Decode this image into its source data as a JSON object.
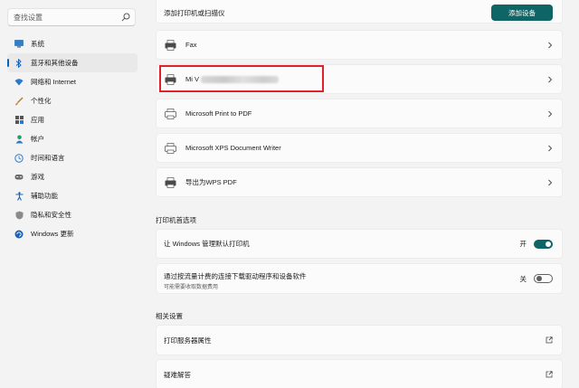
{
  "sidebar": {
    "search_placeholder": "查找设置",
    "items": [
      {
        "label": "系统",
        "icon": "monitor-icon"
      },
      {
        "label": "蓝牙和其他设备",
        "icon": "bluetooth-icon",
        "active": true
      },
      {
        "label": "网络和 Internet",
        "icon": "wifi-icon"
      },
      {
        "label": "个性化",
        "icon": "brush-icon"
      },
      {
        "label": "应用",
        "icon": "apps-icon"
      },
      {
        "label": "帐户",
        "icon": "person-icon"
      },
      {
        "label": "时间和语言",
        "icon": "globe-clock-icon"
      },
      {
        "label": "游戏",
        "icon": "gamepad-icon"
      },
      {
        "label": "辅助功能",
        "icon": "accessibility-icon"
      },
      {
        "label": "隐私和安全性",
        "icon": "shield-icon"
      },
      {
        "label": "Windows 更新",
        "icon": "update-icon"
      }
    ]
  },
  "main": {
    "add_printer_label": "添加打印机或扫描仪",
    "add_device_button": "添加设备",
    "printers": [
      {
        "label": "Fax",
        "icon": "printer-icon"
      },
      {
        "label": "Mi V",
        "icon": "printer-icon",
        "redacted": true
      },
      {
        "label": "Microsoft Print to PDF",
        "icon": "printer-pdf-icon"
      },
      {
        "label": "Microsoft XPS Document Writer",
        "icon": "printer-pdf-icon"
      },
      {
        "label": "导出为WPS PDF",
        "icon": "printer-icon"
      }
    ],
    "prefs_title": "打印机首选项",
    "pref_default": {
      "label": "让 Windows 管理默认打印机",
      "state": "开",
      "on": true
    },
    "pref_metered": {
      "label": "通过按流量计费的连接下载驱动程序和设备软件",
      "sublabel": "可能需要收取数据费用",
      "state": "关",
      "on": false
    },
    "related_title": "相关设置",
    "related": [
      {
        "label": "打印服务器属性"
      },
      {
        "label": "疑难解答"
      }
    ]
  },
  "colors": {
    "accent": "#0f6565",
    "highlight": "#e0202a",
    "nav_indicator": "#0067c0"
  }
}
